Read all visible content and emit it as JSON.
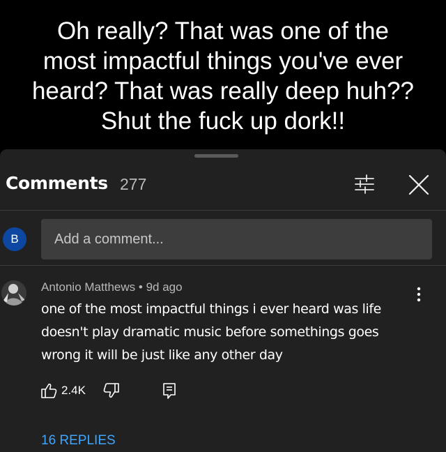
{
  "caption": {
    "lines": [
      "Oh really? That was one of the",
      "most impactful things you've ever",
      "heard? That was really deep huh??",
      "Shut the fuck up dork!!"
    ]
  },
  "comments_panel": {
    "title": "Comments",
    "count": "277",
    "filter_icon": "sort-filter-icon",
    "close_icon": "close-icon"
  },
  "add_comment": {
    "avatar_letter": "B",
    "placeholder": "Add a comment..."
  },
  "comment": {
    "author": "Antonio Matthews",
    "separator": "•",
    "age": "9d ago",
    "text": "one of the most impactful things i ever heard was life doesn't play dramatic music before somethings goes wrong it will be just like any other day",
    "likes": "2.4K",
    "replies_label": "16 REPLIES"
  },
  "colors": {
    "caption_bg": "#000000",
    "panel_bg": "#212121",
    "input_bg": "#3d3d3d",
    "link": "#3ea6ff",
    "avatar_bg": "#0d47a1"
  }
}
